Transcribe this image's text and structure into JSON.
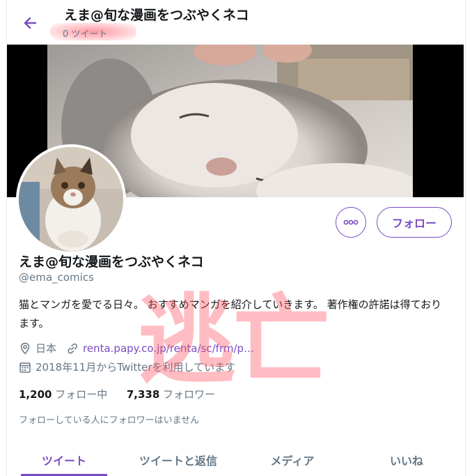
{
  "header": {
    "name": "えま@旬な漫画をつぶやくネコ",
    "tweet_count": "0 ツイート"
  },
  "profile": {
    "display_name": "えま@旬な漫画をつぶやくネコ",
    "handle": "@ema_comics",
    "bio": "猫とマンガを愛でる日々。 おすすめマンガを紹介していきます。 著作権の許諾は得ております。",
    "location": "日本",
    "url": "renta.papy.co.jp/renta/sc/frm/p…",
    "joined": "2018年11月からTwitterを利用しています"
  },
  "actions": {
    "follow_label": "フォロー",
    "more_label": "°°°"
  },
  "stats": {
    "following_count": "1,200",
    "following_label": "フォロー中",
    "followers_count": "7,338",
    "followers_label": "フォロワー"
  },
  "followers_note": "フォローしている人にフォロワーはいません",
  "tabs": [
    {
      "label": "ツイート",
      "active": true
    },
    {
      "label": "ツイートと返信",
      "active": false
    },
    {
      "label": "メディア",
      "active": false
    },
    {
      "label": "いいね",
      "active": false
    }
  ],
  "watermark": "逃亡",
  "colors": {
    "accent": "#794bc4",
    "secondary_text": "#657786",
    "watermark": "#ff505f"
  },
  "icons": [
    "back-arrow-icon",
    "more-dots-icon",
    "location-pin-icon",
    "link-icon",
    "calendar-icon"
  ]
}
